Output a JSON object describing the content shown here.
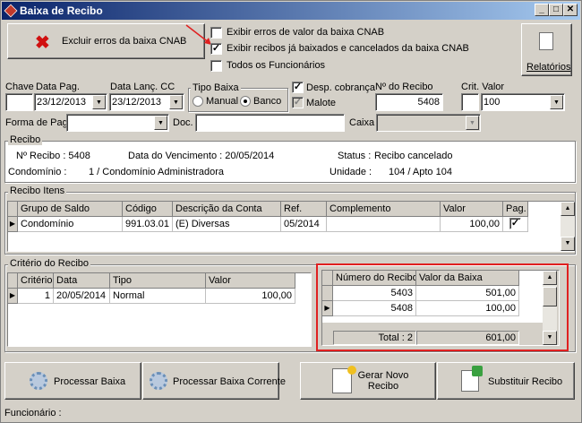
{
  "window": {
    "title": "Baixa de Recibo"
  },
  "top": {
    "excluir_label": "Excluir erros da baixa CNAB",
    "chk_erros_label": "Exibir erros de valor da baixa CNAB",
    "chk_exibir_label": "Exibir recibos já baixados e cancelados da baixa CNAB",
    "chk_todos_label": "Todos os Funcionários",
    "relatorios_label": "Relatórios"
  },
  "filters": {
    "chave_label": "Chave",
    "chave_value": "",
    "data_pag_label": "Data Pag.",
    "data_pag_value": "23/12/2013",
    "data_lanc_label": "Data Lanç. CC",
    "data_lanc_value": "23/12/2013",
    "tipo_baixa_label": "Tipo Baixa",
    "manual_label": "Manual",
    "banco_label": "Banco",
    "desp_label": "Desp. cobrança",
    "malote_label": "Malote",
    "num_recibo_label": "Nº do Recibo",
    "num_recibo_value": "5408",
    "crit_valor_label": "Crit. Valor",
    "crit_valor_value": "100",
    "forma_pag_label": "Forma de Pag.",
    "doc_label": "Doc.",
    "caixa_label": "Caixa"
  },
  "recibo": {
    "group_label": "Recibo",
    "num": "Nº Recibo : 5408",
    "vencimento": "Data do Vencimento : 20/05/2014",
    "status_label": "Status :",
    "status_value": "Recibo cancelado",
    "condominio_label": "Condomínio :",
    "condominio_value": "1 /  Condomínio Administradora",
    "unidade_label": "Unidade :",
    "unidade_value": "104 /  Apto 104"
  },
  "itens": {
    "group_label": "Recibo Itens",
    "columns": [
      "Grupo de Saldo",
      "Código",
      "Descrição da Conta",
      "Ref.",
      "Complemento",
      "Valor",
      "Pag."
    ],
    "row": {
      "grupo": "Condomínio",
      "codigo": "991.03.01",
      "descricao": "(E) Diversas",
      "ref": "05/2014",
      "complemento": "",
      "valor": "100,00",
      "pag": true
    }
  },
  "criterio": {
    "group_label": "Critério do Recibo",
    "columns": [
      "Critério",
      "Data",
      "Tipo",
      "Valor"
    ],
    "row": {
      "criterio": "1",
      "data": "20/05/2014",
      "tipo": "Normal",
      "valor": "100,00"
    }
  },
  "baixa": {
    "columns": [
      "Número do Recibo",
      "Valor da Baixa"
    ],
    "rows": [
      {
        "numero": "5403",
        "valor": "501,00"
      },
      {
        "numero": "5408",
        "valor": "100,00"
      }
    ],
    "total_label": "Total : 2",
    "total_value": "601,00"
  },
  "actions": {
    "processar": "Processar Baixa",
    "processar_corrente": "Processar Baixa Corrente",
    "gerar_novo": "Gerar Novo Recibo",
    "substituir": "Substituir Recibo"
  },
  "status": {
    "funcionario_label": "Funcionário :"
  }
}
